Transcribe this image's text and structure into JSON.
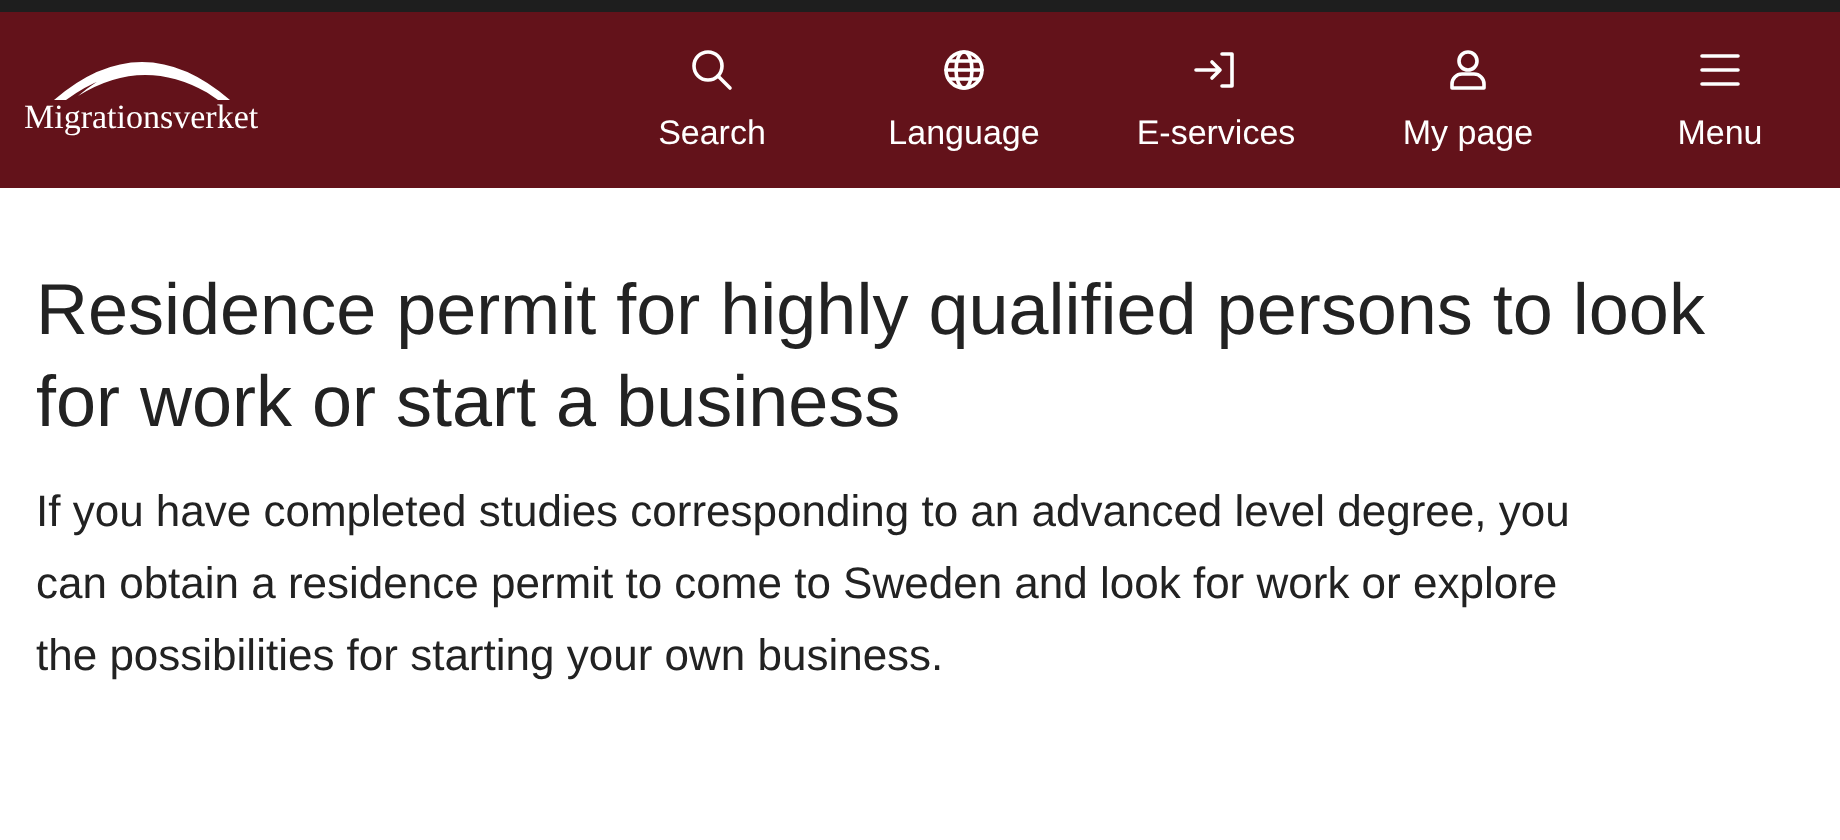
{
  "header": {
    "logo_text": "Migrationsverket",
    "nav": [
      {
        "kind": "search",
        "label": "Search"
      },
      {
        "kind": "language",
        "label": "Language"
      },
      {
        "kind": "eservices",
        "label": "E-services"
      },
      {
        "kind": "mypage",
        "label": "My page"
      },
      {
        "kind": "menu",
        "label": "Menu"
      }
    ]
  },
  "page": {
    "title": "Residence permit for highly qualified persons to look for work or start a business",
    "intro": "If you have completed studies corresponding to an advanced level degree, you can obtain a residence permit to come to Sweden and look for work or explore the possibilities for starting your own business."
  }
}
